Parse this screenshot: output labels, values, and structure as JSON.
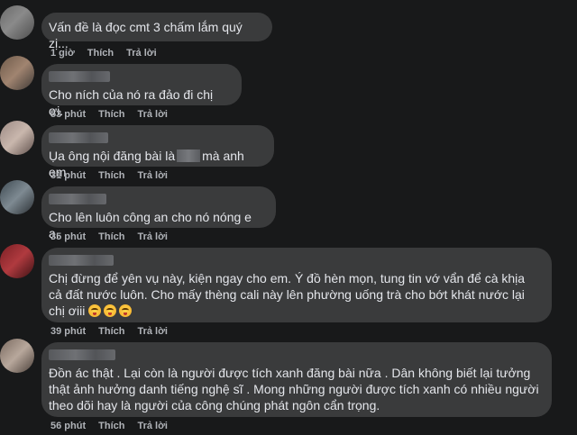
{
  "comments": [
    {
      "text": "Vấn đề là đọc cmt 3 chấm lắm quý zị...",
      "time": "1 giờ",
      "like": "Thích",
      "reply": "Trả lời",
      "avatar_colors": [
        "#6b6b6b",
        "#8a8a8a",
        "#4d4d4d"
      ]
    },
    {
      "text": "Cho ních của nó ra đảo đi chị ơi.",
      "time": "53 phút",
      "like": "Thích",
      "reply": "Trả lời",
      "avatar_colors": [
        "#6e5a4a",
        "#a08470",
        "#3f3a36"
      ]
    },
    {
      "text_before": "Ụa ông nội đăng bài là",
      "text_after": "mà anh em",
      "time": "31 phút",
      "like": "Thích",
      "reply": "Trả lời",
      "avatar_colors": [
        "#9c8a84",
        "#c9b7ad",
        "#5e4f4b"
      ]
    },
    {
      "text": "Cho lên luôn công an cho nó nóng e ạ.",
      "time": "35 phút",
      "like": "Thích",
      "reply": "Trả lời",
      "avatar_colors": [
        "#3e4a52",
        "#7e8a92",
        "#2a2f33"
      ]
    },
    {
      "text": "Chị đừng để yên vụ này, kiện ngay cho em. Ý đồ hèn mọn, tung tin vớ vẩn để cà khịa cả đất nước luôn. Cho mấy thèng cali này lên phường uống trà cho bớt khát nước lại chị ơiii",
      "time": "39 phút",
      "like": "Thích",
      "reply": "Trả lời",
      "emojis": [
        "kiss-emoji",
        "kiss-emoji",
        "kiss-emoji"
      ],
      "avatar_colors": [
        "#7a1f24",
        "#b03a3f",
        "#3c1214"
      ]
    },
    {
      "text": "Đồn ác thật . Lại còn là người được tích xanh đăng bài nữa . Dân không biết lại tưởng thật ảnh hưởng danh tiếng nghệ sĩ . Mong những người được tích xanh có nhiều người theo dõi hay là người của công chúng phát ngôn cẩn trọng.",
      "time": "56 phút",
      "like": "Thích",
      "reply": "Trả lời",
      "avatar_colors": [
        "#7a6a60",
        "#b8a89c",
        "#4a3f39"
      ]
    }
  ]
}
